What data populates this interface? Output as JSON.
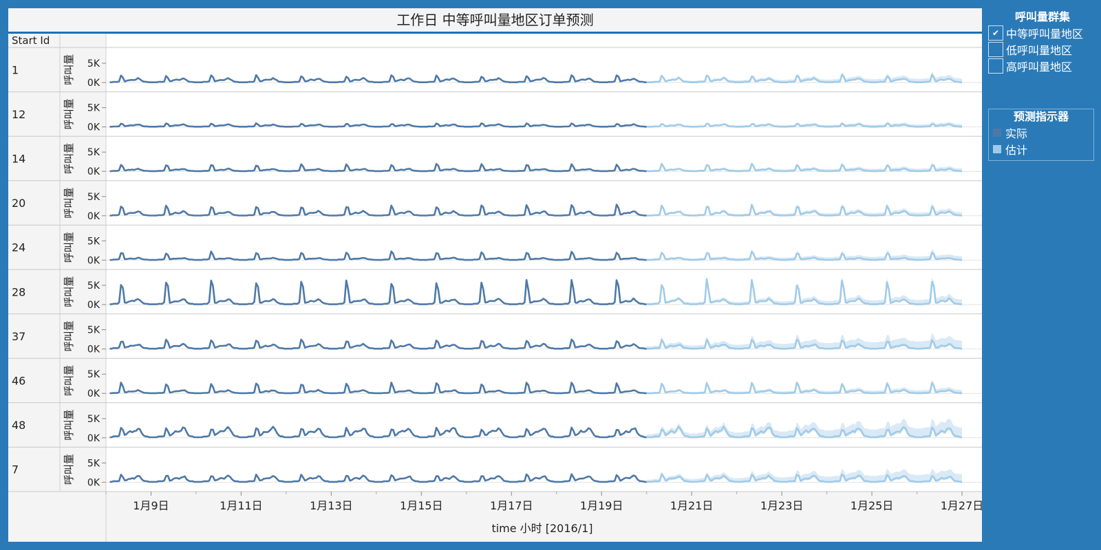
{
  "title": "工作日 中等呼叫量地区订单预测",
  "legend_cluster": {
    "title": "呼叫量群集",
    "items": [
      {
        "label": "中等呼叫量地区",
        "checked": true
      },
      {
        "label": "低呼叫量地区",
        "checked": false
      },
      {
        "label": "高呼叫量地区",
        "checked": false
      }
    ]
  },
  "legend_indicator": {
    "title": "预测指示器",
    "items": [
      {
        "label": "实际",
        "color": "#4e79a7"
      },
      {
        "label": "估计",
        "color": "#a0cbe8"
      }
    ]
  },
  "chart_data": {
    "type": "line",
    "row_header": "Start Id",
    "ylabel": "呼叫量",
    "yticks": [
      "5K",
      "0K"
    ],
    "ytick_values": [
      5000,
      0
    ],
    "xlabel": "time 小时 [2016/1]",
    "xticks": [
      "1月9日",
      "1月11日",
      "1月13日",
      "1月15日",
      "1月17日",
      "1月19日",
      "1月21日",
      "1月23日",
      "1月25日",
      "1月27日"
    ],
    "xtick_values": [
      "2016-01-09",
      "2016-01-11",
      "2016-01-13",
      "2016-01-15",
      "2016-01-17",
      "2016-01-19",
      "2016-01-21",
      "2016-01-23",
      "2016-01-25",
      "2016-01-27"
    ],
    "x_range": [
      "2016-01-08",
      "2016-01-27"
    ],
    "forecast_start": "2016-01-20",
    "colors": {
      "actual": "#4e79a7",
      "estimate": "#a0cbe8",
      "band": "#cfe3f3"
    },
    "rows": [
      {
        "start_id": "1",
        "base": 400,
        "peak": 2000,
        "bump": 900,
        "band": 700
      },
      {
        "start_id": "12",
        "base": 300,
        "peak": 900,
        "bump": 500,
        "band": 450
      },
      {
        "start_id": "14",
        "base": 300,
        "peak": 2000,
        "bump": 500,
        "band": 500
      },
      {
        "start_id": "20",
        "base": 350,
        "peak": 3000,
        "bump": 1000,
        "band": 600
      },
      {
        "start_id": "24",
        "base": 400,
        "peak": 2300,
        "bump": 400,
        "band": 700
      },
      {
        "start_id": "28",
        "base": 500,
        "peak": 7000,
        "bump": 1200,
        "band": 900
      },
      {
        "start_id": "37",
        "base": 500,
        "peak": 2500,
        "bump": 1000,
        "band": 1500
      },
      {
        "start_id": "46",
        "base": 300,
        "peak": 3000,
        "bump": 700,
        "band": 600
      },
      {
        "start_id": "48",
        "base": 900,
        "peak": 2500,
        "bump": 2200,
        "band": 1800
      },
      {
        "start_id": "7",
        "base": 600,
        "peak": 2000,
        "bump": 1300,
        "band": 1400
      }
    ]
  }
}
